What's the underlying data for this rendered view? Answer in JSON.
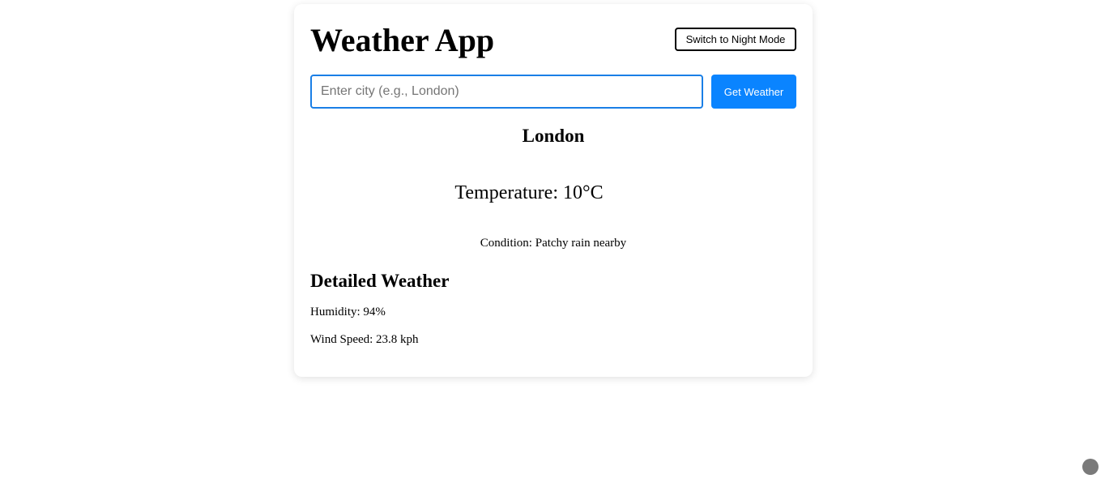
{
  "header": {
    "title": "Weather App",
    "mode_button_label": "Switch to Night Mode"
  },
  "search": {
    "placeholder": "Enter city (e.g., London)",
    "value": "",
    "button_label": "Get Weather"
  },
  "current": {
    "city": "London",
    "temperature_text": "Temperature: 10°C",
    "condition_text": "Condition: Patchy rain nearby"
  },
  "details": {
    "title": "Detailed Weather",
    "humidity_text": "Humidity: 94%",
    "wind_text": "Wind Speed: 23.8 kph"
  },
  "colors": {
    "accent": "#0a84ff",
    "input_border": "#1a7fe6",
    "corner_indicator": "#7a7a7a"
  }
}
